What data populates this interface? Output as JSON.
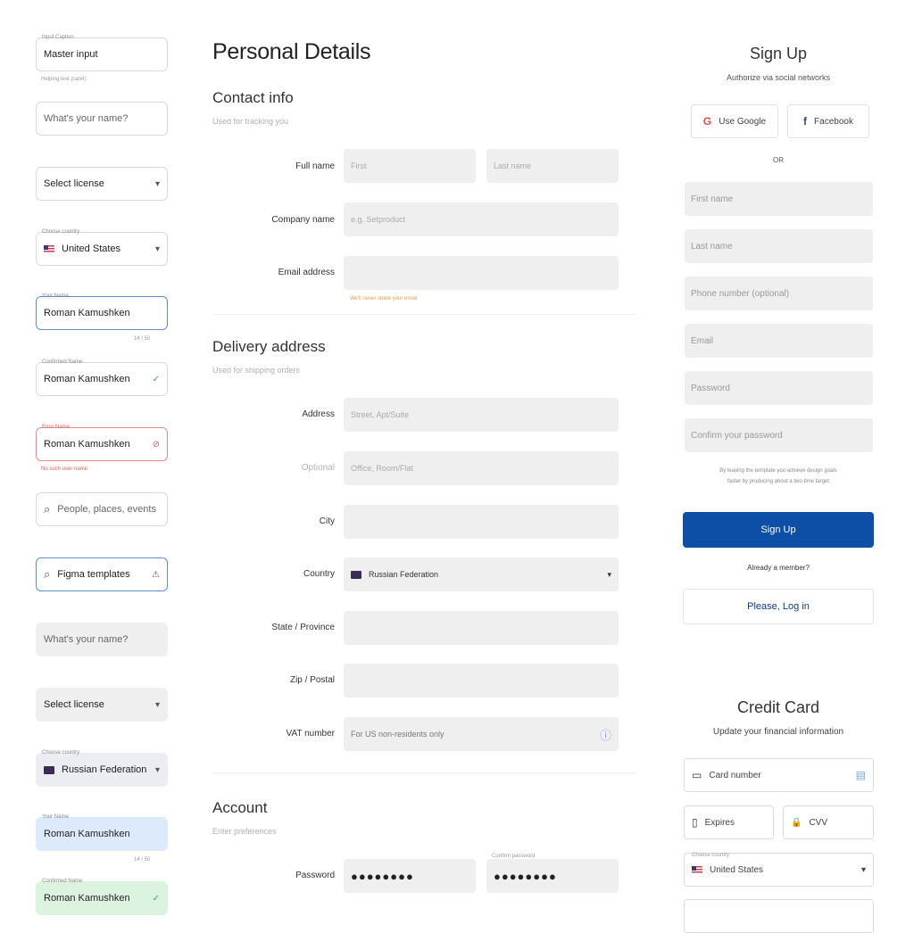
{
  "left": {
    "f1": {
      "caption": "Input Caption",
      "value": "Master input",
      "helper": "Helping text (caret)"
    },
    "f2": {
      "placeholder": "What's your name?"
    },
    "f3": {
      "value": "Select license",
      "trail": "▾"
    },
    "f4": {
      "caption": "Choose country",
      "value": "United States",
      "trail": "▾"
    },
    "f5": {
      "caption": "Your Name",
      "value": "Roman Kamushken",
      "counter": "14 / 50"
    },
    "f6": {
      "caption": "Confirmed Name",
      "value": "Roman Kamushken",
      "trail": "✓"
    },
    "f7": {
      "caption": "Error Name",
      "value": "Roman Kamushken",
      "trail": "⊘",
      "helper": "No such user name"
    },
    "f8": {
      "placeholder": "People, places, events",
      "icon": "⌕"
    },
    "f9": {
      "value": "Figma templates",
      "icon": "⌕",
      "trail": "⚠"
    },
    "f10": {
      "placeholder": "What's your name?"
    },
    "f11": {
      "value": "Select license",
      "trail": "▾"
    },
    "f12": {
      "caption": "Choose country",
      "value": "Russian Federation",
      "trail": "▾"
    },
    "f13": {
      "caption": "Your Name",
      "value": "Roman Kamushken",
      "counter": "14 / 50"
    },
    "f14": {
      "caption": "Confirmed Name",
      "value": "Roman Kamushken",
      "trail": "✓"
    }
  },
  "mid": {
    "title": "Personal Details",
    "contact": {
      "heading": "Contact info",
      "sub": "Used for tracking you",
      "full_name_label": "Full name",
      "first_ph": "First",
      "last_ph": "Last name",
      "company_label": "Company name",
      "company_ph": "e.g. Setproduct",
      "email_label": "Email address",
      "email_warning": "We'll never share your email"
    },
    "delivery": {
      "heading": "Delivery address",
      "sub": "Used for shipping orders",
      "address_label": "Address",
      "address_ph": "Street, Apt/Suite",
      "optional_label": "Optional",
      "optional_ph": "Office, Room/Flat",
      "city_label": "City",
      "country_label": "Country",
      "country_value": "Russian Federation",
      "state_label": "State / Province",
      "zip_label": "Zip / Postal",
      "vat_label": "VAT number",
      "vat_value": "For US non-residents only",
      "vat_icon": "ⓘ"
    },
    "account": {
      "heading": "Account",
      "sub": "Enter preferences",
      "password_label": "Password",
      "password_dots": "●●●●●●●●",
      "confirm_caption": "Confirm password",
      "confirm_dots": "●●●●●●●●"
    }
  },
  "right": {
    "signup": {
      "title": "Sign Up",
      "subtitle": "Authorize via social networks",
      "google_icon": "G",
      "google_label": "Use Google",
      "facebook_icon": "f",
      "facebook_label": "Facebook",
      "or": "OR",
      "first_ph": "First name",
      "last_ph": "Last name",
      "phone_ph": "Phone number (optional)",
      "email_ph": "Email",
      "password_ph": "Password",
      "confirm_ph": "Confirm your password",
      "terms_1": "By leaving the template you achieve design goals",
      "terms_2": "faster by producing about a two-time target",
      "button": "Sign Up",
      "already": "Already a member?",
      "login": "Please, Log in"
    },
    "credit": {
      "title": "Credit Card",
      "subtitle": "Update your financial information",
      "card_icon": "▭",
      "card_label": "Card number",
      "card_trail": "▤",
      "expires_icon": "▯",
      "expires_label": "Expires",
      "cvv_icon": "🔒",
      "cvv_label": "CVV",
      "country_caption": "Choose country",
      "country_value": "United States",
      "country_trail": "▾"
    }
  }
}
